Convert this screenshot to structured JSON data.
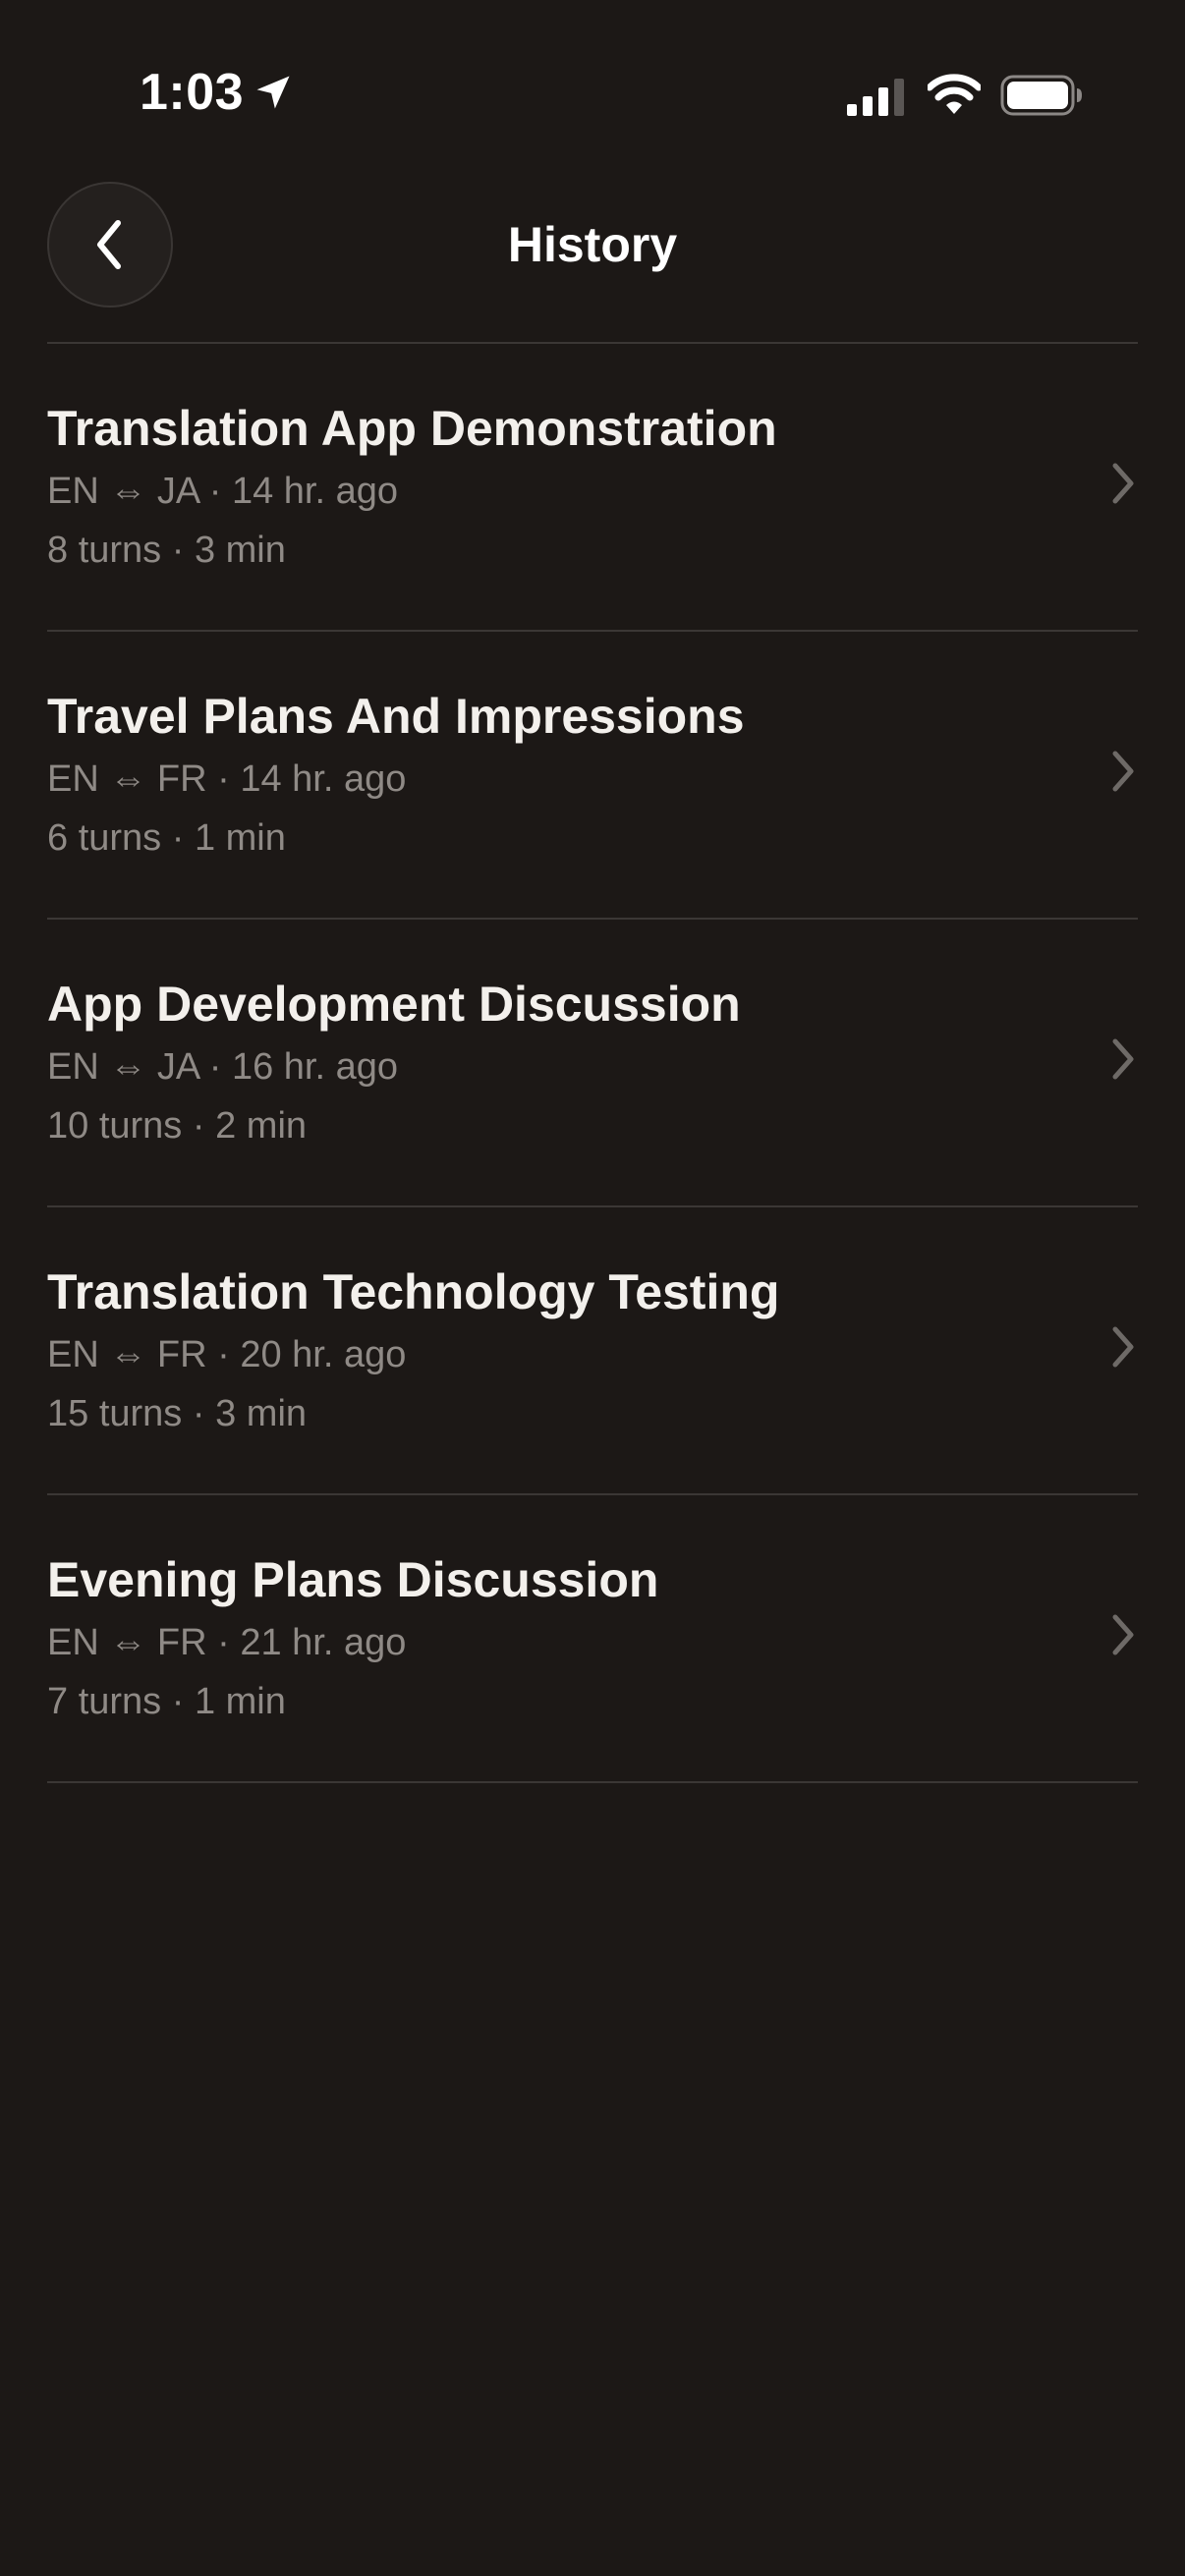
{
  "status_bar": {
    "time": "1:03",
    "icons": [
      "location-arrow-icon",
      "cellular-signal-icon",
      "wifi-icon",
      "battery-icon"
    ]
  },
  "header": {
    "title": "History",
    "back_icon": "chevron-left-icon"
  },
  "colors": {
    "background": "#1c1816",
    "primary_text": "#f3f0ec",
    "secondary_text": "#8f8a86",
    "divider": "#3b3735"
  },
  "history": [
    {
      "title": "Translation App Demonstration",
      "languages": "EN ⇔ JA",
      "time_ago": "14 hr. ago",
      "turns": "8 turns",
      "duration": "3 min"
    },
    {
      "title": "Travel Plans And Impressions",
      "languages": "EN ⇔ FR",
      "time_ago": "14 hr. ago",
      "turns": "6 turns",
      "duration": "1 min"
    },
    {
      "title": "App Development Discussion",
      "languages": "EN ⇔ JA",
      "time_ago": "16 hr. ago",
      "turns": "10 turns",
      "duration": "2 min"
    },
    {
      "title": "Translation Technology Testing",
      "languages": "EN ⇔ FR",
      "time_ago": "20 hr. ago",
      "turns": "15 turns",
      "duration": "3 min"
    },
    {
      "title": "Evening Plans Discussion",
      "languages": "EN ⇔ FR",
      "time_ago": "21 hr. ago",
      "turns": "7 turns",
      "duration": "1 min"
    }
  ]
}
